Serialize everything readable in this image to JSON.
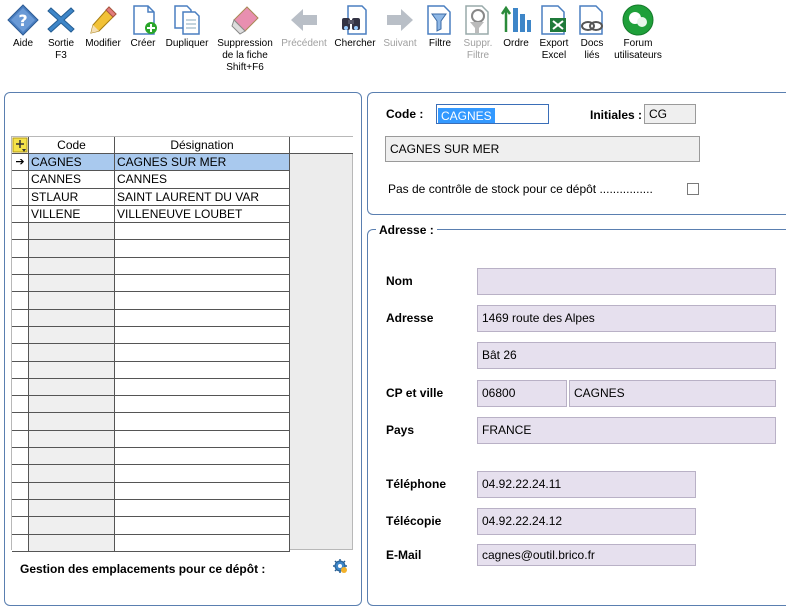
{
  "toolbar": {
    "aide": "Aide",
    "sortie": "Sortie\nF3",
    "modifier": "Modifier",
    "creer": "Créer",
    "dupliquer": "Dupliquer",
    "suppression": "Suppression\nde la fiche\nShift+F6",
    "precedent": "Précédent",
    "chercher": "Chercher",
    "suivant": "Suivant",
    "filtre": "Filtre",
    "suppr_filtre": "Suppr.\nFiltre",
    "ordre": "Ordre",
    "export_excel": "Export\nExcel",
    "docs_lies": "Docs\nliés",
    "forum": "Forum\nutilisateurs"
  },
  "grid": {
    "col_code": "Code",
    "col_designation": "Désignation",
    "rows": [
      {
        "code": "CAGNES",
        "designation": "CAGNES SUR MER",
        "marker": "➔"
      },
      {
        "code": "CANNES",
        "designation": "CANNES",
        "marker": ""
      },
      {
        "code": "STLAUR",
        "designation": "SAINT LAURENT DU VAR",
        "marker": ""
      },
      {
        "code": "VILLENE",
        "designation": "VILLENEUVE LOUBET",
        "marker": ""
      }
    ]
  },
  "gestion_label": "Gestion des emplacements pour ce dépôt  :",
  "form": {
    "code_label": "Code :",
    "code_value": "CAGNES",
    "initiales_label": "Initiales :",
    "initiales_value": "CG",
    "designation_value": "CAGNES SUR MER",
    "stock_label": "Pas de contrôle de stock pour ce dépôt ................"
  },
  "address": {
    "legend": "Adresse :",
    "nom_label": "Nom",
    "nom_value": "",
    "adresse_label": "Adresse",
    "adresse1": "1469 route des Alpes",
    "adresse2": "Bât 26",
    "cp_label": "CP et ville",
    "cp_value": "06800",
    "ville_value": "CAGNES",
    "pays_label": "Pays",
    "pays_value": "FRANCE",
    "tel_label": "Téléphone",
    "tel_value": "04.92.22.24.11",
    "fax_label": "Télécopie",
    "fax_value": "04.92.22.24.12",
    "email_label": "E-Mail",
    "email_value": "cagnes@outil.brico.fr"
  },
  "colors": {
    "panel_border": "#5a7fb0",
    "field_bg": "#e6e0ee",
    "selection": "#a9c9ee"
  }
}
